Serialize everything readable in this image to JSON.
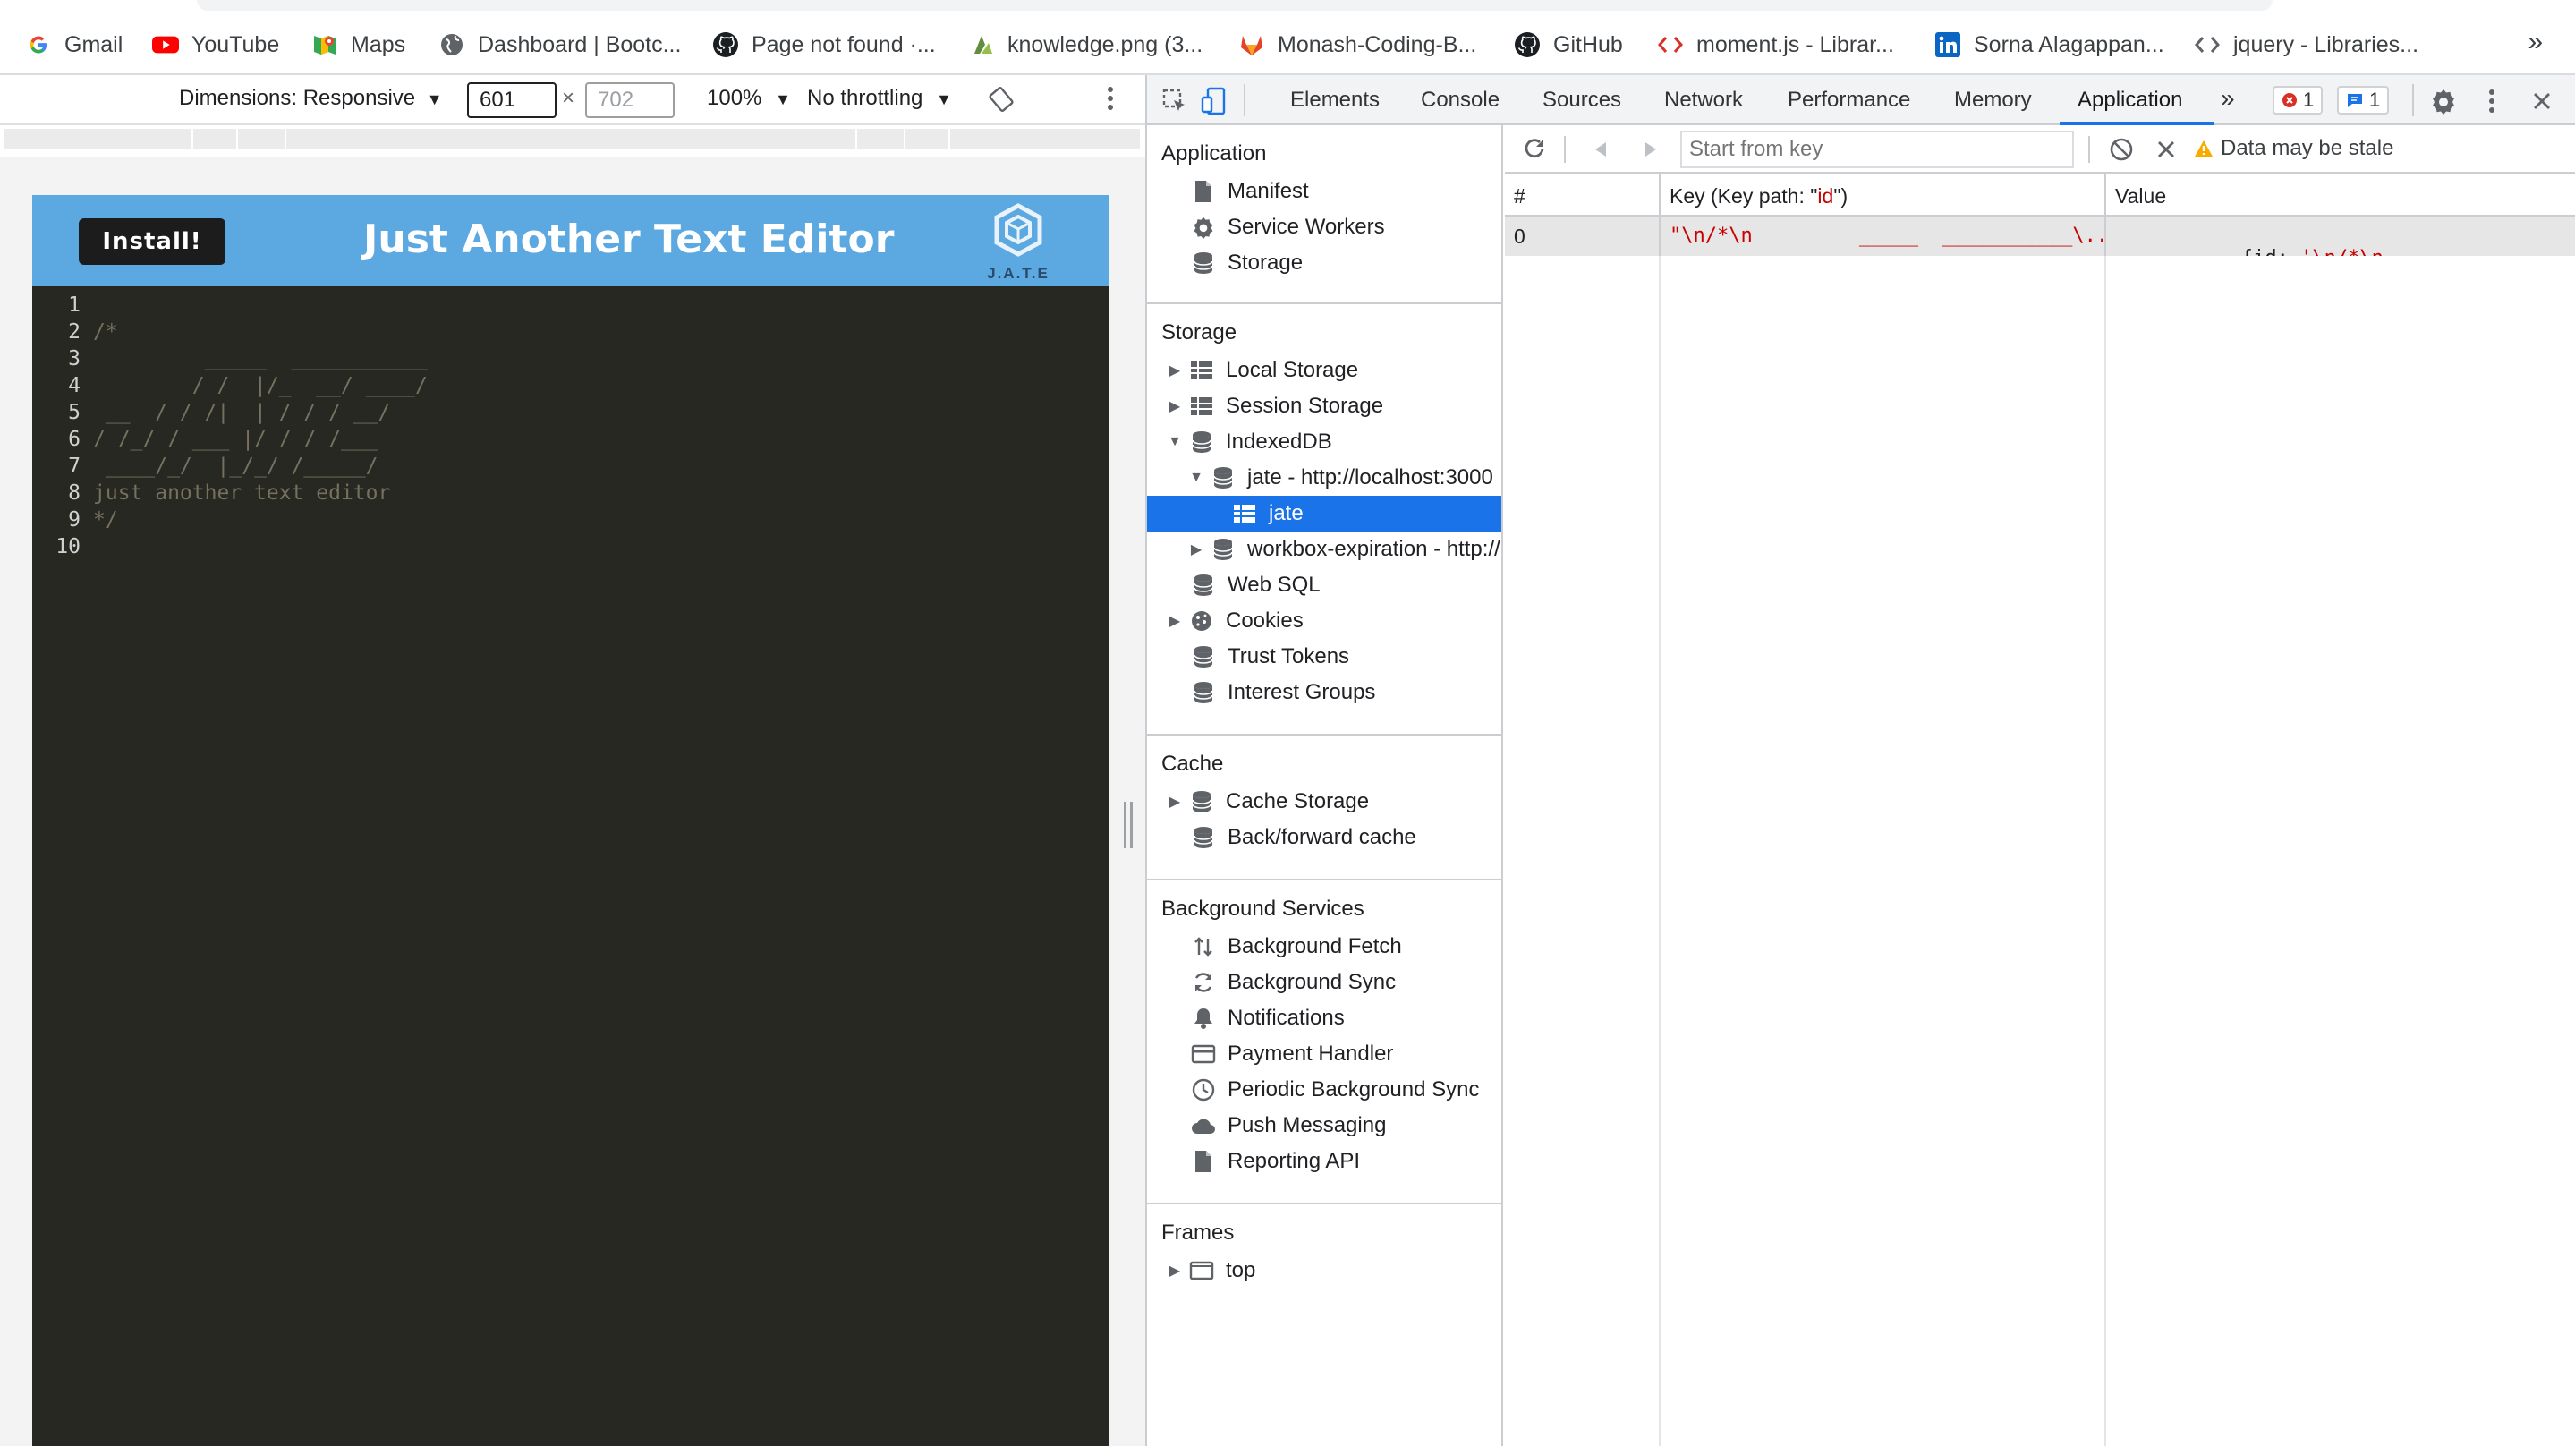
{
  "bookmarks": [
    {
      "label": "Gmail",
      "icon": "google-icon"
    },
    {
      "label": "YouTube",
      "icon": "youtube-icon"
    },
    {
      "label": "Maps",
      "icon": "maps-icon"
    },
    {
      "label": "Dashboard | Bootc...",
      "icon": "globe-icon"
    },
    {
      "label": "Page not found ·...",
      "icon": "github-icon"
    },
    {
      "label": "knowledge.png (3...",
      "icon": "image-icon"
    },
    {
      "label": "Monash-Coding-B...",
      "icon": "gitlab-icon"
    },
    {
      "label": "GitHub",
      "icon": "github-icon"
    },
    {
      "label": "moment.js - Librar...",
      "icon": "code-icon"
    },
    {
      "label": "Sorna Alagappan...",
      "icon": "linkedin-icon"
    },
    {
      "label": "jquery - Libraries...",
      "icon": "code-icon"
    }
  ],
  "bookmarks_more": "»",
  "device_toolbar": {
    "dimensions_label": "Dimensions: Responsive",
    "width_value": "601",
    "times": "×",
    "height_value": "702",
    "zoom": "100%",
    "throttling": "No throttling"
  },
  "app": {
    "install_label": "Install!",
    "title": "Just Another Text Editor",
    "logo_text": "J.A.T.E",
    "editor_lines": [
      {
        "n": "1",
        "text": ""
      },
      {
        "n": "2",
        "text": "/*"
      },
      {
        "n": "3",
        "text": "         _____  ___________"
      },
      {
        "n": "4",
        "text": "        / /  |/_  __/ ____/"
      },
      {
        "n": "5",
        "text": " __  / / /|  | / / / __/"
      },
      {
        "n": "6",
        "text": "/ /_/ / ___ |/ / / /___"
      },
      {
        "n": "7",
        "text": " ____/_/  |_/_/ /_____/"
      },
      {
        "n": "8",
        "text": "just another text editor"
      },
      {
        "n": "9",
        "text": "*/"
      },
      {
        "n": "10",
        "text": ""
      }
    ]
  },
  "devtools": {
    "tabs": [
      "Elements",
      "Console",
      "Sources",
      "Network",
      "Performance",
      "Memory",
      "Application"
    ],
    "active_tab": "Application",
    "more_tabs": "»",
    "error_count": "1",
    "message_count": "1",
    "sidebar": {
      "application_title": "Application",
      "application_items": [
        "Manifest",
        "Service Workers",
        "Storage"
      ],
      "storage_title": "Storage",
      "storage_items": {
        "local_storage": "Local Storage",
        "session_storage": "Session Storage",
        "indexeddb": "IndexedDB",
        "db_jate": "jate - http://localhost:3000",
        "store_jate": "jate",
        "db_workbox": "workbox-expiration - http://",
        "web_sql": "Web SQL",
        "cookies": "Cookies",
        "trust_tokens": "Trust Tokens",
        "interest_groups": "Interest Groups"
      },
      "cache_title": "Cache",
      "cache_items": [
        "Cache Storage",
        "Back/forward cache"
      ],
      "background_title": "Background Services",
      "background_items": [
        "Background Fetch",
        "Background Sync",
        "Notifications",
        "Payment Handler",
        "Periodic Background Sync",
        "Push Messaging",
        "Reporting API"
      ],
      "frames_title": "Frames",
      "frames_items": [
        "top"
      ]
    },
    "idb": {
      "key_placeholder": "Start from key",
      "stale_text": "Data may be stale",
      "columns": {
        "index": "#",
        "key_prefix": "Key (Key path: \"",
        "key_path": "id",
        "key_suffix": "\")",
        "value": "Value"
      },
      "rows": [
        {
          "index": "0",
          "key": "\"\\n/*\\n         _____  ___________\\...",
          "value_prefix": "{id: ",
          "value": "'\\n/*\\n         _____  ________"
        }
      ]
    }
  },
  "colors": {
    "app_header": "#5ca8e0",
    "editor_bg": "#272822",
    "selection": "#1a73e8",
    "accent_red": "#c80000"
  }
}
